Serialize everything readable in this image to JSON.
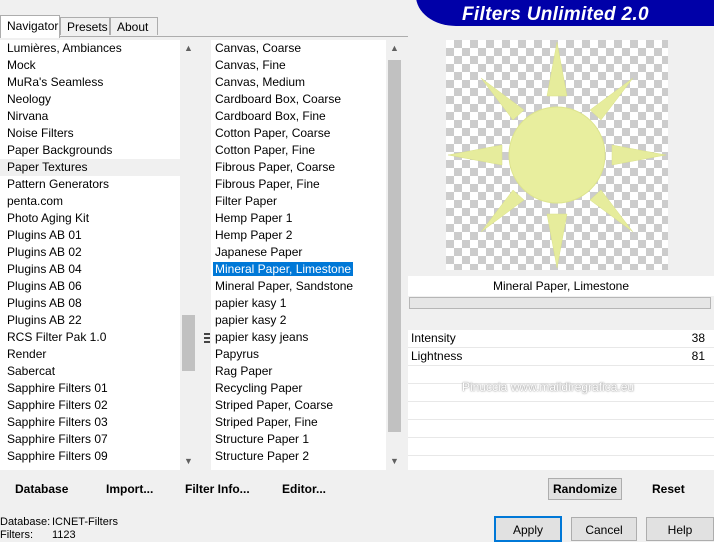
{
  "tabs": [
    {
      "label": "Navigator",
      "active": true
    },
    {
      "label": "Presets",
      "active": false
    },
    {
      "label": "About",
      "active": false
    }
  ],
  "title": "Filters Unlimited 2.0",
  "categories": [
    "Lumières, Ambiances",
    "Mock",
    "MuRa's Seamless",
    "Neology",
    "Nirvana",
    "Noise Filters",
    "Paper Backgrounds",
    "Paper Textures",
    "Pattern Generators",
    "penta.com",
    "Photo Aging Kit",
    "Plugins AB 01",
    "Plugins AB 02",
    "Plugins AB 04",
    "Plugins AB 06",
    "Plugins AB 08",
    "Plugins AB 22",
    "RCS Filter Pak 1.0",
    "Render",
    "Sabercat",
    "Sapphire Filters 01",
    "Sapphire Filters 02",
    "Sapphire Filters 03",
    "Sapphire Filters 07",
    "Sapphire Filters 09"
  ],
  "selected_category": "Paper Textures",
  "filters": [
    "Canvas, Coarse",
    "Canvas, Fine",
    "Canvas, Medium",
    "Cardboard Box, Coarse",
    "Cardboard Box, Fine",
    "Cotton Paper, Coarse",
    "Cotton Paper, Fine",
    "Fibrous Paper, Coarse",
    "Fibrous Paper, Fine",
    "Filter Paper",
    "Hemp Paper 1",
    "Hemp Paper 2",
    "Japanese Paper",
    "Mineral Paper, Limestone",
    "Mineral Paper, Sandstone",
    "papier kasy 1",
    "papier kasy 2",
    "papier kasy jeans",
    "Papyrus",
    "Rag Paper",
    "Recycling Paper",
    "Striped Paper, Coarse",
    "Striped Paper, Fine",
    "Structure Paper 1",
    "Structure Paper 2"
  ],
  "selected_filter": "Mineral Paper, Limestone",
  "preview_label": "Mineral Paper, Limestone",
  "params": [
    {
      "name": "Intensity",
      "value": "38"
    },
    {
      "name": "Lightness",
      "value": "81"
    }
  ],
  "toolbar": {
    "database": "Database",
    "import": "Import...",
    "filter_info": "Filter Info...",
    "editor": "Editor...",
    "randomize": "Randomize",
    "reset": "Reset"
  },
  "status": {
    "database_label": "Database:",
    "database_value": "ICNET-Filters",
    "filters_label": "Filters:",
    "filters_value": "1123"
  },
  "buttons": {
    "apply": "Apply",
    "cancel": "Cancel",
    "help": "Help"
  },
  "watermark": "Pinuccia  www.maildiregrafica.eu",
  "colors": {
    "banner": "#0000a8",
    "selection": "#0078d7",
    "sun": "#e6ec9c"
  }
}
